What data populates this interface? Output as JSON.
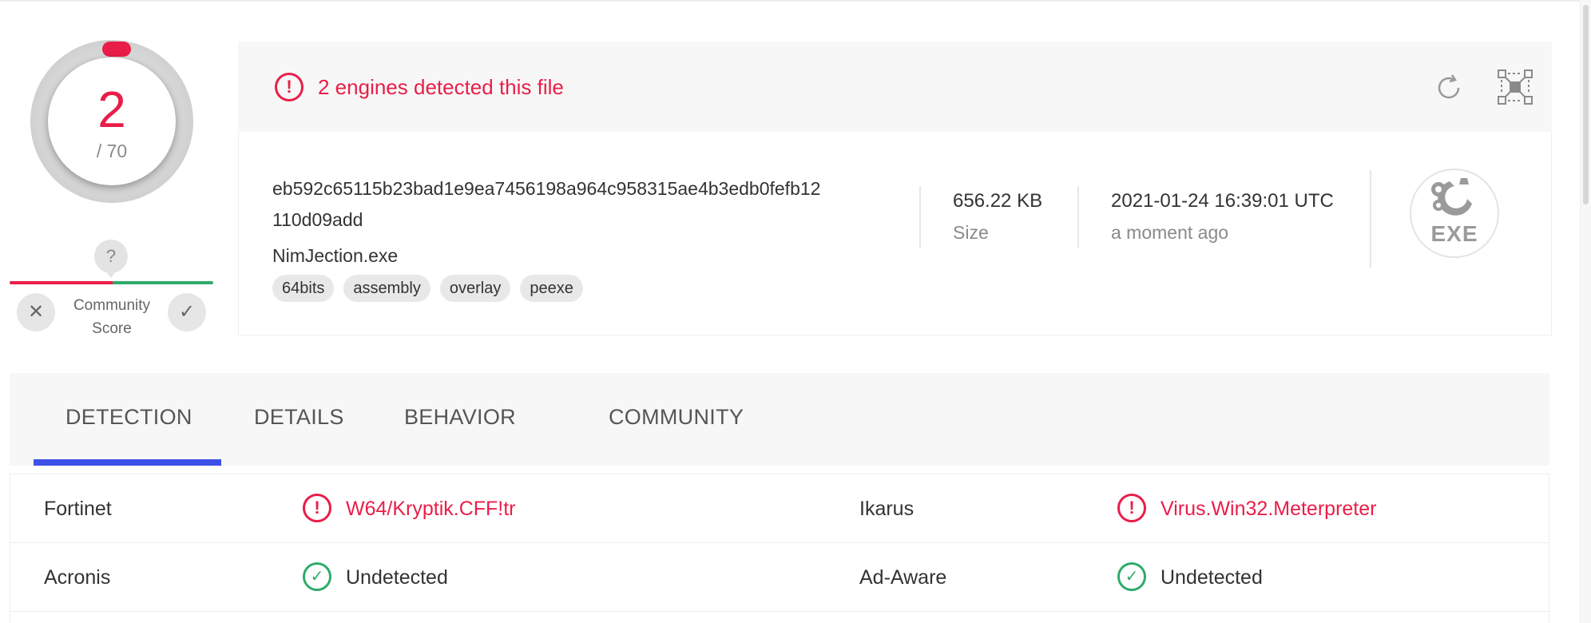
{
  "score": {
    "detected": "2",
    "total": "/ 70"
  },
  "community": {
    "question": "?",
    "label_line1": "Community",
    "label_line2": "Score",
    "down": "✕",
    "up": "✓"
  },
  "banner": {
    "alert": "!",
    "text": "2 engines detected this file"
  },
  "file": {
    "hash_line1": "eb592c65115b23bad1e9ea7456198a964c958315ae4b3edb0fefb12",
    "hash_line2": "110d09add",
    "name": "NimJection.exe",
    "tags": [
      "64bits",
      "assembly",
      "overlay",
      "peexe"
    ],
    "size_value": "656.22 KB",
    "size_label": "Size",
    "date_value": "2021-01-24 16:39:01 UTC",
    "date_relative": "a moment ago",
    "type_icon_label": "EXE"
  },
  "tabs": [
    "DETECTION",
    "DETAILS",
    "BEHAVIOR",
    "COMMUNITY"
  ],
  "results": [
    {
      "engine": "Fortinet",
      "status": "alert",
      "result": "W64/Kryptik.CFF!tr"
    },
    {
      "engine": "Ikarus",
      "status": "alert",
      "result": "Virus.Win32.Meterpreter"
    },
    {
      "engine": "Acronis",
      "status": "ok",
      "result": "Undetected"
    },
    {
      "engine": "Ad-Aware",
      "status": "ok",
      "result": "Undetected"
    }
  ],
  "icons": {
    "alert": "!",
    "ok": "✓"
  },
  "colors": {
    "danger": "#e91e48",
    "success": "#2fab6a",
    "accent": "#3c51e8"
  }
}
